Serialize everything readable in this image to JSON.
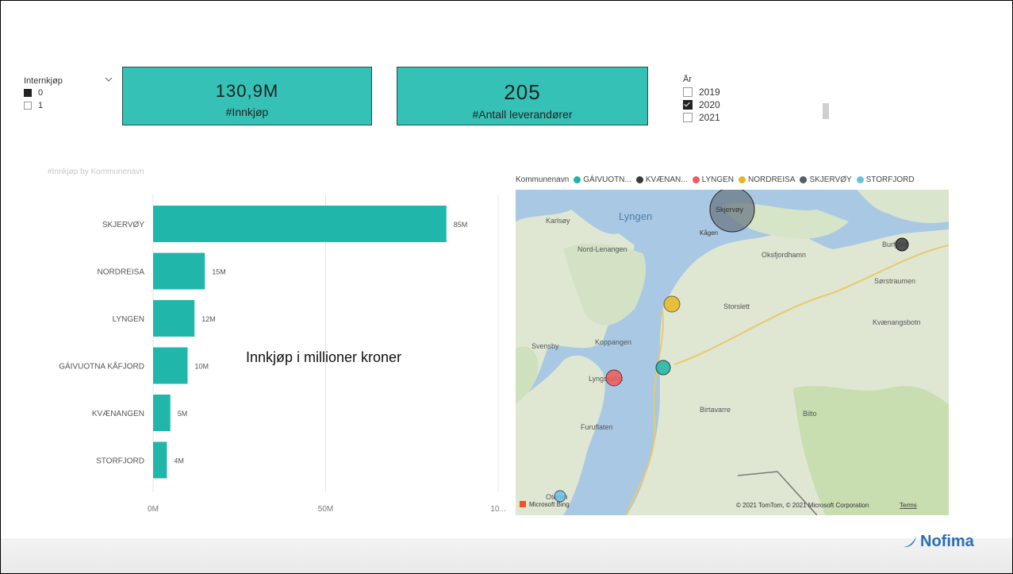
{
  "slicer_internkjop": {
    "title": "Internkjøp",
    "options": [
      {
        "label": "0",
        "selected": true
      },
      {
        "label": "1",
        "selected": false
      }
    ]
  },
  "card_innkjop": {
    "value": "130,9M",
    "label": "#Innkjøp"
  },
  "card_leverandorer": {
    "value": "205",
    "label": "#Antall leverandører"
  },
  "slicer_ar": {
    "title": "År",
    "options": [
      {
        "label": "2019",
        "checked": false
      },
      {
        "label": "2020",
        "checked": true
      },
      {
        "label": "2021",
        "checked": false
      }
    ]
  },
  "chart_data": {
    "type": "bar",
    "title": "#Innkjøp by Kommunenavn",
    "categories": [
      "SKJERVØY",
      "NORDREISA",
      "LYNGEN",
      "GÁIVUOTNA KÅFJORD",
      "KVÆNANGEN",
      "STORFJORD"
    ],
    "values": [
      85,
      15,
      12,
      10,
      5,
      4
    ],
    "data_labels": [
      "85M",
      "15M",
      "12M",
      "10M",
      "5M",
      "4M"
    ],
    "x_ticks": [
      "0M",
      "50M",
      "10..."
    ],
    "xlim": [
      0,
      100
    ],
    "orientation": "horizontal",
    "color": "#20b7aa"
  },
  "annotation": "Innkjøp i millioner kroner",
  "map": {
    "legend_title": "Kommunenavn",
    "legend_items": [
      {
        "label": "GÁIVUOTN...",
        "color": "#1fb3a8"
      },
      {
        "label": "KVÆNAN...",
        "color": "#3a3a3a"
      },
      {
        "label": "LYNGEN",
        "color": "#f05a5a"
      },
      {
        "label": "NORDREISA",
        "color": "#e8b61e"
      },
      {
        "label": "SKJERVØY",
        "color": "#555f66"
      },
      {
        "label": "STORFJORD",
        "color": "#6cc3e0"
      }
    ],
    "place_labels": {
      "lyngen": "Lyngen",
      "karlsoy": "Karlsøy",
      "skjervoy": "Skjervøy",
      "kagen": "Kågen",
      "nord_lenangen": "Nord-Lenangen",
      "oksfjordhamn": "Oksfjordhamn",
      "burfjord": "Burfjord",
      "sorstraumen": "Sørstraumen",
      "storslett": "Storslett",
      "kvaenangsbotn": "Kvænangsbotn",
      "svensby": "Svensby",
      "koppangen": "Koppangen",
      "lyngseidet": "Lyngseidet",
      "birtavarre": "Birtavarre",
      "bilto": "Bilto",
      "furuflaten": "Furuflaten",
      "oteren": "Oteren"
    },
    "attribution_left": "Microsoft Bing",
    "attribution_right": "© 2021 TomTom, © 2021 Microsoft Corporation",
    "terms": "Terms"
  },
  "logo_text": "Nofima"
}
